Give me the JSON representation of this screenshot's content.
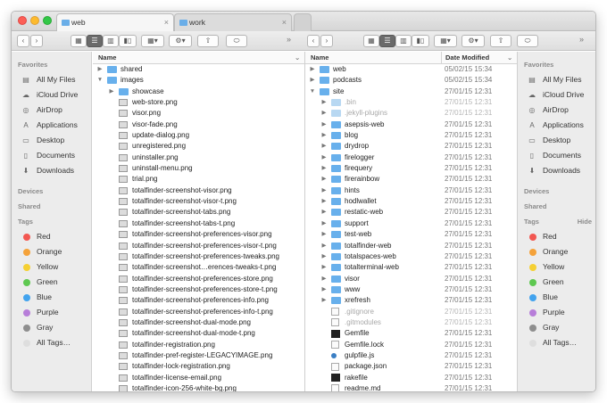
{
  "tabs": [
    {
      "label": "web"
    },
    {
      "label": "work"
    }
  ],
  "tabs_close": "×",
  "toolbar": {
    "back": "‹",
    "forward": "›",
    "overflow": "»"
  },
  "sidebar_left": {
    "favorites_heading": "Favorites",
    "favorites": [
      {
        "label": "All My Files",
        "icon": "all-files-icon",
        "glyph": "▤"
      },
      {
        "label": "iCloud Drive",
        "icon": "cloud-icon",
        "glyph": "☁"
      },
      {
        "label": "AirDrop",
        "icon": "airdrop-icon",
        "glyph": "◎"
      },
      {
        "label": "Applications",
        "icon": "applications-icon",
        "glyph": "A"
      },
      {
        "label": "Desktop",
        "icon": "desktop-icon",
        "glyph": "▭"
      },
      {
        "label": "Documents",
        "icon": "documents-icon",
        "glyph": "▯"
      },
      {
        "label": "Downloads",
        "icon": "downloads-icon",
        "glyph": "⬇"
      }
    ],
    "devices_heading": "Devices",
    "shared_heading": "Shared",
    "tags_heading": "Tags",
    "tags": [
      {
        "label": "Red",
        "color": "#f25751"
      },
      {
        "label": "Orange",
        "color": "#f4a23a"
      },
      {
        "label": "Yellow",
        "color": "#f5d033"
      },
      {
        "label": "Green",
        "color": "#5ec850"
      },
      {
        "label": "Blue",
        "color": "#42a3ee"
      },
      {
        "label": "Purple",
        "color": "#b77ed9"
      },
      {
        "label": "Gray",
        "color": "#8e8e8e"
      },
      {
        "label": "All Tags…",
        "color": "#dedede"
      }
    ]
  },
  "sidebar_right": {
    "favorites_heading": "Favorites",
    "devices_heading": "Devices",
    "shared_heading": "Shared",
    "tags_heading": "Tags",
    "hide_label": "Hide"
  },
  "left_pane": {
    "name_header": "Name",
    "sort_indicator": "⌄",
    "rows": [
      {
        "name": "shared",
        "icon": "folder",
        "disclosure": "▶",
        "level": 0
      },
      {
        "name": "images",
        "icon": "folder",
        "disclosure": "▼",
        "level": 0
      },
      {
        "name": "showcase",
        "icon": "folder",
        "disclosure": "▶",
        "level": 1
      },
      {
        "name": "web-store.png",
        "icon": "img",
        "level": 1
      },
      {
        "name": "visor.png",
        "icon": "img",
        "level": 1
      },
      {
        "name": "visor-fade.png",
        "icon": "img",
        "level": 1
      },
      {
        "name": "update-dialog.png",
        "icon": "img",
        "level": 1
      },
      {
        "name": "unregistered.png",
        "icon": "img",
        "level": 1
      },
      {
        "name": "uninstaller.png",
        "icon": "img",
        "level": 1
      },
      {
        "name": "uninstall-menu.png",
        "icon": "img",
        "level": 1
      },
      {
        "name": "trial.png",
        "icon": "img",
        "level": 1
      },
      {
        "name": "totalfinder-screenshot-visor.png",
        "icon": "img",
        "level": 1
      },
      {
        "name": "totalfinder-screenshot-visor-t.png",
        "icon": "img",
        "level": 1
      },
      {
        "name": "totalfinder-screenshot-tabs.png",
        "icon": "img",
        "level": 1
      },
      {
        "name": "totalfinder-screenshot-tabs-t.png",
        "icon": "img",
        "level": 1
      },
      {
        "name": "totalfinder-screenshot-preferences-visor.png",
        "icon": "img",
        "level": 1
      },
      {
        "name": "totalfinder-screenshot-preferences-visor-t.png",
        "icon": "img",
        "level": 1
      },
      {
        "name": "totalfinder-screenshot-preferences-tweaks.png",
        "icon": "img",
        "level": 1
      },
      {
        "name": "totalfinder-screenshot…erences-tweaks-t.png",
        "icon": "img",
        "level": 1
      },
      {
        "name": "totalfinder-screenshot-preferences-store.png",
        "icon": "img",
        "level": 1
      },
      {
        "name": "totalfinder-screenshot-preferences-store-t.png",
        "icon": "img",
        "level": 1
      },
      {
        "name": "totalfinder-screenshot-preferences-info.png",
        "icon": "img",
        "level": 1
      },
      {
        "name": "totalfinder-screenshot-preferences-info-t.png",
        "icon": "img",
        "level": 1
      },
      {
        "name": "totalfinder-screenshot-dual-mode.png",
        "icon": "img",
        "level": 1
      },
      {
        "name": "totalfinder-screenshot-dual-mode-t.png",
        "icon": "img",
        "level": 1
      },
      {
        "name": "totalfinder-registration.png",
        "icon": "img",
        "level": 1
      },
      {
        "name": "totalfinder-pref-register-LEGACYIMAGE.png",
        "icon": "img",
        "level": 1
      },
      {
        "name": "totalfinder-lock-registration.png",
        "icon": "img",
        "level": 1
      },
      {
        "name": "totalfinder-license-email.png",
        "icon": "img",
        "level": 1
      },
      {
        "name": "totalfinder-icon-256-white-bg.png",
        "icon": "img",
        "level": 1
      }
    ]
  },
  "right_pane": {
    "name_header": "Name",
    "date_header": "Date Modified",
    "sort_indicator": "⌄",
    "rows": [
      {
        "name": "web",
        "date": "05/02/15 15:34",
        "icon": "folder",
        "disclosure": "▶",
        "level": 0
      },
      {
        "name": "podcasts",
        "date": "05/02/15 15:34",
        "icon": "folder",
        "disclosure": "▶",
        "level": 0
      },
      {
        "name": "site",
        "date": "27/01/15 12:31",
        "icon": "folder",
        "disclosure": "▼",
        "level": 0
      },
      {
        "name": ".bin",
        "date": "27/01/15 12:31",
        "icon": "folder",
        "disclosure": "▶",
        "level": 1,
        "dim": true
      },
      {
        "name": ".jekyll-plugins",
        "date": "27/01/15 12:31",
        "icon": "folder",
        "disclosure": "▶",
        "level": 1,
        "dim": true
      },
      {
        "name": "asepsis-web",
        "date": "27/01/15 12:31",
        "icon": "folder",
        "disclosure": "▶",
        "level": 1
      },
      {
        "name": "blog",
        "date": "27/01/15 12:31",
        "icon": "folder",
        "disclosure": "▶",
        "level": 1
      },
      {
        "name": "drydrop",
        "date": "27/01/15 12:31",
        "icon": "folder",
        "disclosure": "▶",
        "level": 1
      },
      {
        "name": "firelogger",
        "date": "27/01/15 12:31",
        "icon": "folder",
        "disclosure": "▶",
        "level": 1
      },
      {
        "name": "firequery",
        "date": "27/01/15 12:31",
        "icon": "folder",
        "disclosure": "▶",
        "level": 1
      },
      {
        "name": "firerainbow",
        "date": "27/01/15 12:31",
        "icon": "folder",
        "disclosure": "▶",
        "level": 1
      },
      {
        "name": "hints",
        "date": "27/01/15 12:31",
        "icon": "folder",
        "disclosure": "▶",
        "level": 1
      },
      {
        "name": "hodlwallet",
        "date": "27/01/15 12:31",
        "icon": "folder",
        "disclosure": "▶",
        "level": 1
      },
      {
        "name": "restatic-web",
        "date": "27/01/15 12:31",
        "icon": "folder",
        "disclosure": "▶",
        "level": 1
      },
      {
        "name": "support",
        "date": "27/01/15 12:31",
        "icon": "folder",
        "disclosure": "▶",
        "level": 1
      },
      {
        "name": "test-web",
        "date": "27/01/15 12:31",
        "icon": "folder",
        "disclosure": "▶",
        "level": 1
      },
      {
        "name": "totalfinder-web",
        "date": "27/01/15 12:31",
        "icon": "folder",
        "disclosure": "▶",
        "level": 1
      },
      {
        "name": "totalspaces-web",
        "date": "27/01/15 12:31",
        "icon": "folder",
        "disclosure": "▶",
        "level": 1
      },
      {
        "name": "totalterminal-web",
        "date": "27/01/15 12:31",
        "icon": "folder",
        "disclosure": "▶",
        "level": 1
      },
      {
        "name": "visor",
        "date": "27/01/15 12:31",
        "icon": "folder",
        "disclosure": "▶",
        "level": 1
      },
      {
        "name": "www",
        "date": "27/01/15 12:31",
        "icon": "folder",
        "disclosure": "▶",
        "level": 1
      },
      {
        "name": "xrefresh",
        "date": "27/01/15 12:31",
        "icon": "folder",
        "disclosure": "▶",
        "level": 1
      },
      {
        "name": ".gitignore",
        "date": "27/01/15 12:31",
        "icon": "doc",
        "level": 1,
        "dim": true
      },
      {
        "name": ".gitmodules",
        "date": "27/01/15 12:31",
        "icon": "doc",
        "level": 1,
        "dim": true
      },
      {
        "name": "Gemfile",
        "date": "27/01/15 12:31",
        "icon": "exec",
        "level": 1
      },
      {
        "name": "Gemfile.lock",
        "date": "27/01/15 12:31",
        "icon": "doc",
        "level": 1
      },
      {
        "name": "gulpfile.js",
        "date": "27/01/15 12:31",
        "icon": "dot",
        "level": 1
      },
      {
        "name": "package.json",
        "date": "27/01/15 12:31",
        "icon": "doc",
        "level": 1
      },
      {
        "name": "rakefile",
        "date": "27/01/15 12:31",
        "icon": "exec",
        "level": 1
      },
      {
        "name": "readme.md",
        "date": "27/01/15 12:31",
        "icon": "doc",
        "level": 1
      }
    ]
  }
}
